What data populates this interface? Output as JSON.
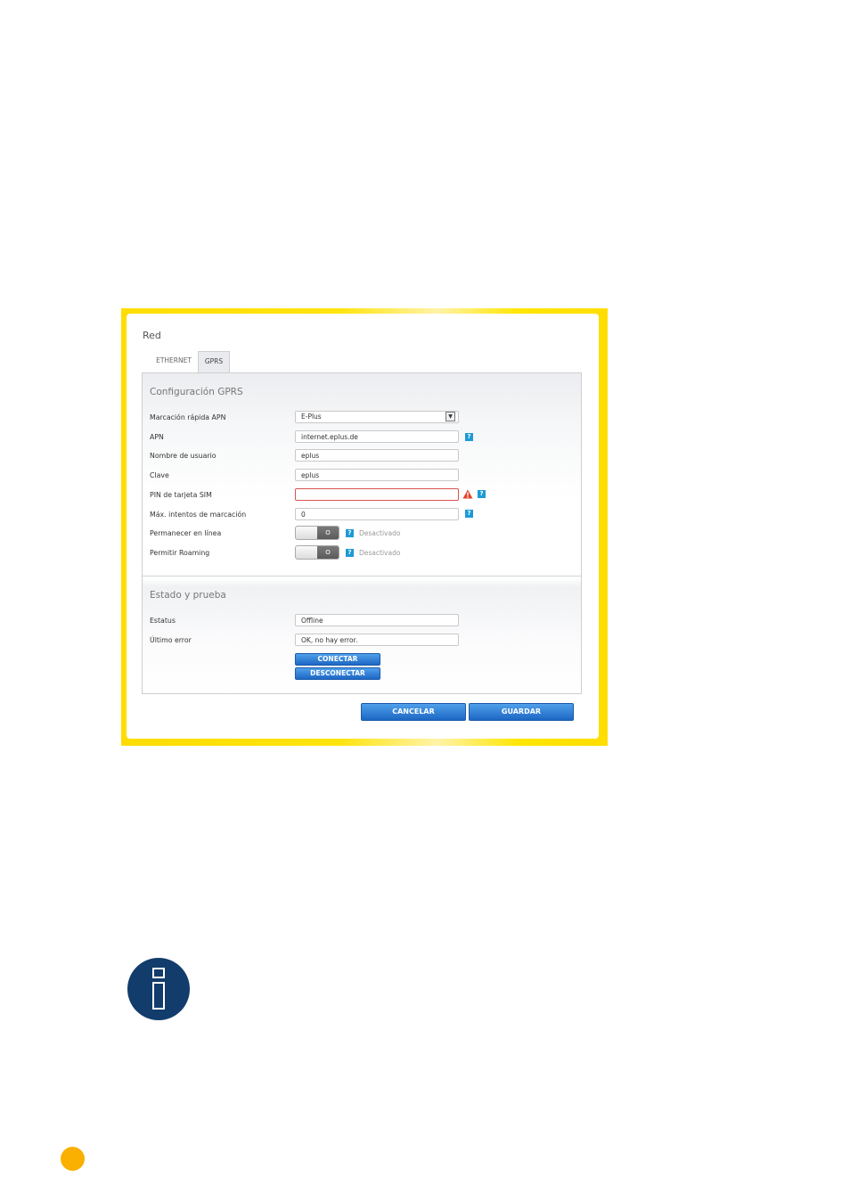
{
  "header": {
    "title": "Red"
  },
  "tabs": [
    {
      "label": "ETHERNET",
      "active": false
    },
    {
      "label": "GPRS",
      "active": true
    }
  ],
  "gprs": {
    "section_title": "Configuración GPRS",
    "apn_quick": {
      "label": "Marcación rápida APN",
      "value": "E-Plus"
    },
    "apn": {
      "label": "APN",
      "value": "internet.eplus.de"
    },
    "username": {
      "label": "Nombre de usuario",
      "value": "eplus"
    },
    "password": {
      "label": "Clave",
      "value": "eplus"
    },
    "sim_pin": {
      "label": "PIN de tarjeta SIM",
      "value": ""
    },
    "max_dial": {
      "label": "Máx. intentos de marcación",
      "value": "0"
    },
    "stay_online": {
      "label": "Permanecer en línea",
      "knob": "O",
      "status": "Desactivado"
    },
    "roaming": {
      "label": "Permitir Roaming",
      "knob": "O",
      "status": "Desactivado"
    }
  },
  "status": {
    "section_title": "Estado y prueba",
    "estatus": {
      "label": "Estatus",
      "value": "Offline"
    },
    "last_error": {
      "label": "Último error",
      "value": "OK, no hay error."
    },
    "connect_label": "CONECTAR",
    "disconnect_label": "DESCONECTAR"
  },
  "footer": {
    "cancel_label": "CANCELAR",
    "save_label": "GUARDAR"
  },
  "help_glyph": "?",
  "colors": {
    "frame": "#ffdd00",
    "button": "#2f7fd6",
    "help": "#1e9ad6",
    "error": "#d9534f",
    "info_circle": "#123c6b",
    "page_dot": "#f9b000"
  },
  "icons": [
    "help-icon",
    "warning-icon",
    "info-icon"
  ]
}
